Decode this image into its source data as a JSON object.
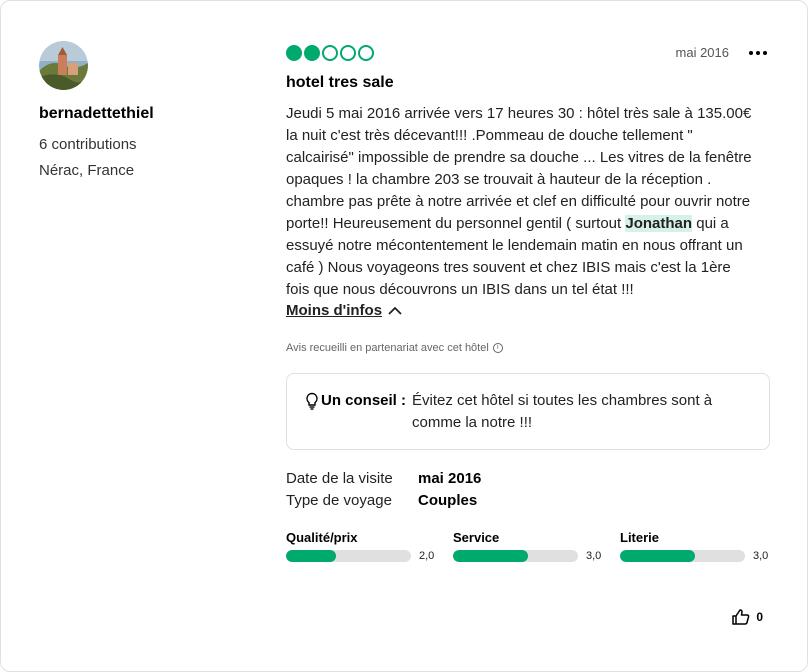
{
  "reviewer": {
    "name": "bernadettethiel",
    "contributions": "6 contributions",
    "location": "Nérac, France"
  },
  "review": {
    "rating": 2,
    "rating_max": 5,
    "date": "mai 2016",
    "title": "hotel tres sale",
    "body_before": "Jeudi 5 mai  2016  arrivée  vers 17 heures  30   : hôtel très sale à 135.00€ la nuit c'est très décevant!!! .Pommeau de douche tellement \" calcairisé\" impossible de prendre sa douche ... Les vitres de la fenêtre opaques ! la chambre  203  se trouvait à hauteur de  la réception . chambre pas prête à notre arrivée et clef  en difficulté  pour ouvrir notre porte!! Heureusement du personnel gentil ( surtout ",
    "highlight": "Jonathan",
    "body_after": " qui a essuyé notre mécontentement le lendemain matin en nous offrant un café ) Nous voyageons tres souvent et chez IBIS mais c'est la 1ère fois que nous découvrons un IBIS dans  un tel état !!!",
    "less_label": "Moins d'infos",
    "partner_note": "Avis recueilli en partenariat avec cet hôtel",
    "tip_label": "Un conseil :",
    "tip_text": "Évitez cet hôtel si toutes les chambres sont à comme la notre !!!",
    "details": {
      "visit_label": "Date de la visite",
      "visit_value": "mai 2016",
      "trip_label": "Type de voyage",
      "trip_value": "Couples"
    },
    "ratings": [
      {
        "name": "Qualité/prix",
        "value": 2.0,
        "display": "2,0"
      },
      {
        "name": "Service",
        "value": 3.0,
        "display": "3,0"
      },
      {
        "name": "Literie",
        "value": 3.0,
        "display": "3,0"
      }
    ],
    "ratings_max": 5,
    "helpful_count": "0"
  },
  "colors": {
    "accent": "#00aa6c",
    "highlight_bg": "#d6f2e6",
    "bar_bg": "#e0e0e0"
  },
  "icons": {
    "more": "more-options-icon",
    "chevron": "chevron-up-icon",
    "info": "info-icon",
    "tip": "lightbulb-icon",
    "helpful": "thumbs-up-icon"
  }
}
